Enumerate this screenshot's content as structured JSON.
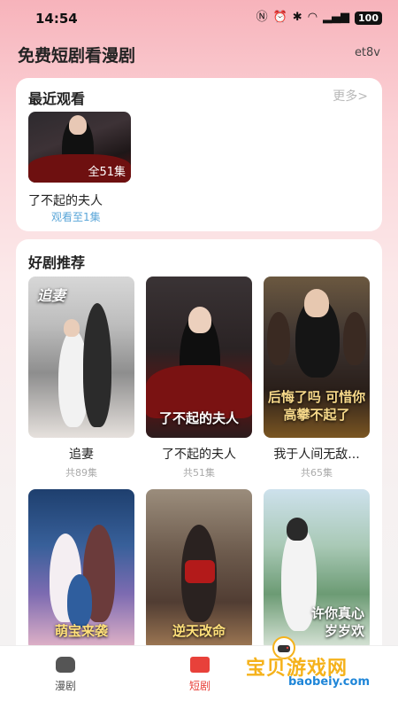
{
  "status": {
    "time": "14:54",
    "icons": [
      "nfc-icon",
      "alarm-icon",
      "bluetooth-icon",
      "wifi-icon",
      "signal-icon"
    ],
    "battery": "100"
  },
  "header": {
    "title": "免费短剧看漫剧",
    "user": "et8v"
  },
  "recent": {
    "title": "最近观看",
    "more": "更多>",
    "item": {
      "title": "了不起的夫人",
      "episodes": "全51集",
      "progress": "观看至1集"
    }
  },
  "recommend": {
    "title": "好剧推荐",
    "items": [
      {
        "name": "追妻",
        "count": "共89集",
        "poster_text": "追妻"
      },
      {
        "name": "了不起的夫人",
        "count": "共51集",
        "poster_text": "了不起的夫人"
      },
      {
        "name": "我于人间无敌...",
        "count": "共65集",
        "poster_text": "后悔了吗 可惜你高攀不起了"
      },
      {
        "name": "",
        "count": "",
        "poster_text": "萌宝来袭"
      },
      {
        "name": "",
        "count": "",
        "poster_text": "逆天改命"
      },
      {
        "name": "",
        "count": "",
        "poster_text": "许你真心 岁岁欢"
      }
    ]
  },
  "nav": {
    "items": [
      {
        "label": "漫剧",
        "active": false
      },
      {
        "label": "短剧",
        "active": true
      }
    ],
    "active_color": "#e8413a",
    "inactive_color": "#555555"
  },
  "watermark": {
    "title": "宝贝游戏网",
    "url": "baobeiy.com"
  }
}
